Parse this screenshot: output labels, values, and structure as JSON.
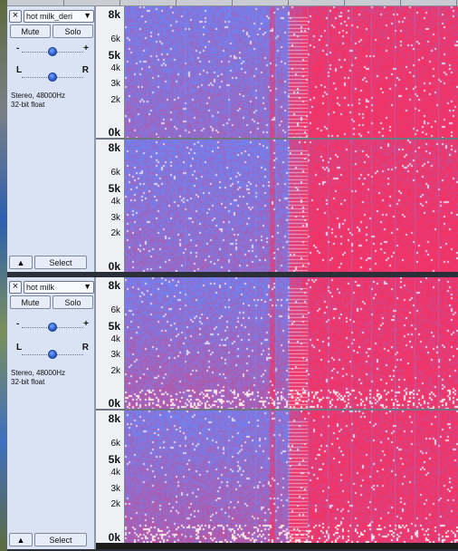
{
  "colors": {
    "panel_bg": "#d9e3f3",
    "spectrogram_blue": "#6d86f0",
    "spectrogram_pink": "#f2356a",
    "selection_knob": "#2f64d6"
  },
  "tracks": [
    {
      "name": "hot milk_deri",
      "close_icon": "×",
      "dropdown_icon": "▼",
      "mute_label": "Mute",
      "solo_label": "Solo",
      "gain_plus": "+",
      "gain_minus": "-",
      "pan_left": "L",
      "pan_right": "R",
      "format_line1": "Stereo, 48000Hz",
      "format_line2": "32-bit float",
      "collapse_icon": "▲",
      "select_label": "Select",
      "gain_level": 0.5,
      "pan_level": 0.5
    },
    {
      "name": "hot milk",
      "close_icon": "×",
      "dropdown_icon": "▼",
      "mute_label": "Mute",
      "solo_label": "Solo",
      "gain_plus": "+",
      "gain_minus": "-",
      "pan_left": "L",
      "pan_right": "R",
      "format_line1": "Stereo, 48000Hz",
      "format_line2": "32-bit float",
      "collapse_icon": "▲",
      "select_label": "Select",
      "gain_level": 0.5,
      "pan_level": 0.5
    }
  ],
  "frequency_axis": {
    "labels": [
      "8k",
      "6k",
      "5k",
      "4k",
      "3k",
      "2k",
      "0k"
    ],
    "bold_labels": [
      "8k",
      "5k",
      "0k"
    ]
  }
}
